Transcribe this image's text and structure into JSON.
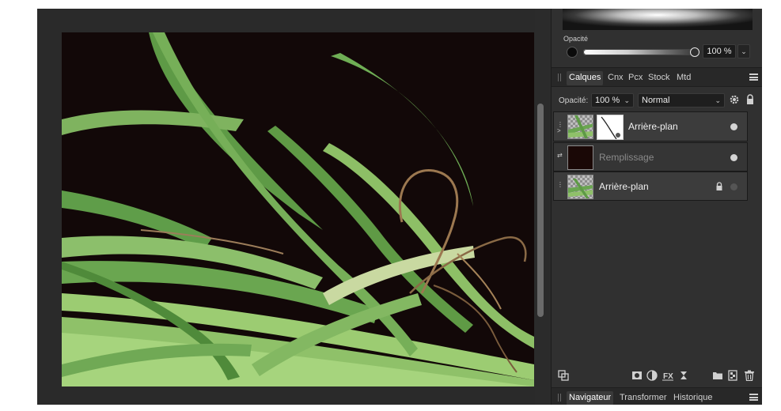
{
  "canvas": {
    "artwork_description_icon": "grass-photo"
  },
  "brush": {
    "opacity_label": "Opacité",
    "opacity_value": "100 %"
  },
  "layers_panel": {
    "tabs": [
      {
        "label": "Calques",
        "active": true
      },
      {
        "label": "Cnx",
        "active": false
      },
      {
        "label": "Pcx",
        "active": false
      },
      {
        "label": "Stock",
        "active": false
      },
      {
        "label": "Mtd",
        "active": false
      }
    ],
    "opacity_label": "Opacité:",
    "opacity_value": "100 %",
    "blend_mode": "Normal",
    "layers": [
      {
        "name": "Arrière-plan",
        "type": "pixel-with-mask",
        "visible": true
      },
      {
        "name": "Remplissage",
        "type": "fill",
        "visible": true
      },
      {
        "name": "Arrière-plan",
        "type": "pixel",
        "visible": false,
        "locked": true
      }
    ]
  },
  "bottom_panel": {
    "tabs": [
      {
        "label": "Navigateur",
        "active": true
      },
      {
        "label": "Transformer",
        "active": false
      },
      {
        "label": "Historique",
        "active": false
      }
    ]
  },
  "colors": {
    "panel_bg": "#303030",
    "canvas_bg": "#2a2a2a",
    "artwork_bg": "#120808",
    "grass_light": "#9bc26a",
    "grass_dark": "#4f8a3a"
  }
}
